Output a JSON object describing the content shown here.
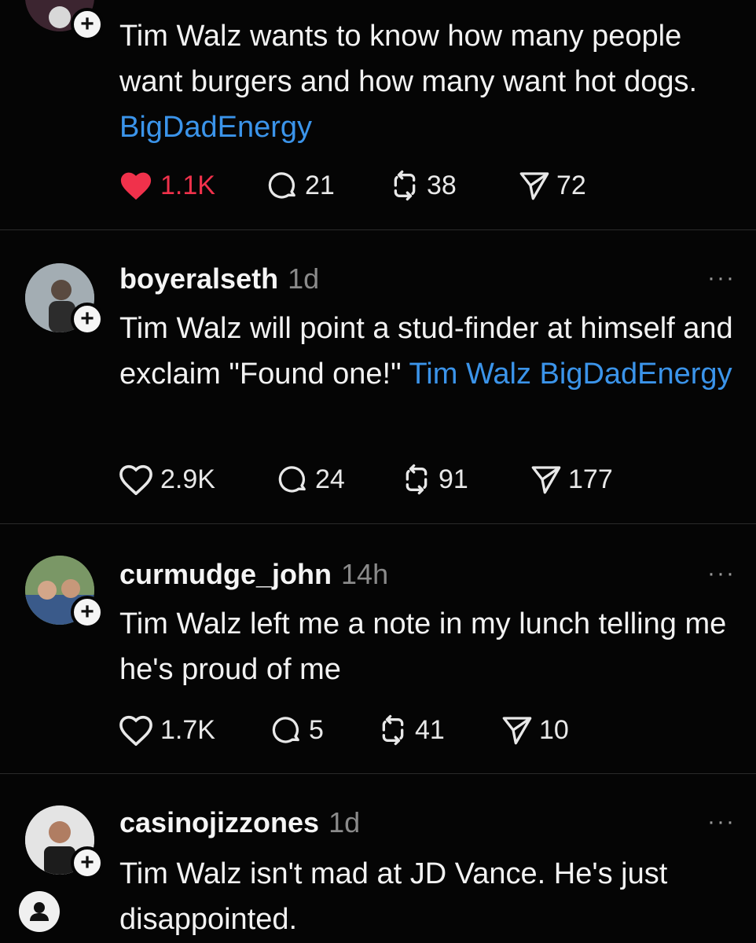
{
  "posts": [
    {
      "username": "",
      "time": "",
      "text": "Tim Walz wants to know how many people want burgers and how many want hot dogs.",
      "link": "BigDadEnergy",
      "likes": "1.1K",
      "liked": true,
      "replies": "21",
      "reposts": "38",
      "shares": "72"
    },
    {
      "username": "boyeralseth",
      "time": "1d",
      "text": "Tim Walz will point a stud-finder at himself and exclaim \"Found one!\"",
      "link": "Tim Walz BigDadEnergy",
      "likes": "2.9K",
      "liked": false,
      "replies": "24",
      "reposts": "91",
      "shares": "177"
    },
    {
      "username": "curmudge_john",
      "time": "14h",
      "text": "Tim Walz left me a note in my lunch telling me he's proud of me",
      "link": "",
      "likes": "1.7K",
      "liked": false,
      "replies": "5",
      "reposts": "41",
      "shares": "10"
    },
    {
      "username": "casinojizzones",
      "time": "1d",
      "text": "Tim Walz isn't mad at JD Vance. He's just disappointed.",
      "link": ""
    }
  ],
  "icons": {
    "like": "heart-icon",
    "reply": "comment-icon",
    "repost": "repost-icon",
    "share": "send-icon",
    "follow": "plus-icon",
    "more": "more-icon",
    "profile": "person-icon"
  },
  "colors": {
    "background": "#050505",
    "link": "#3b94ea",
    "liked": "#f0314b",
    "muted": "#8a8a8a"
  },
  "ui": {
    "plus": "+",
    "more": "···"
  }
}
